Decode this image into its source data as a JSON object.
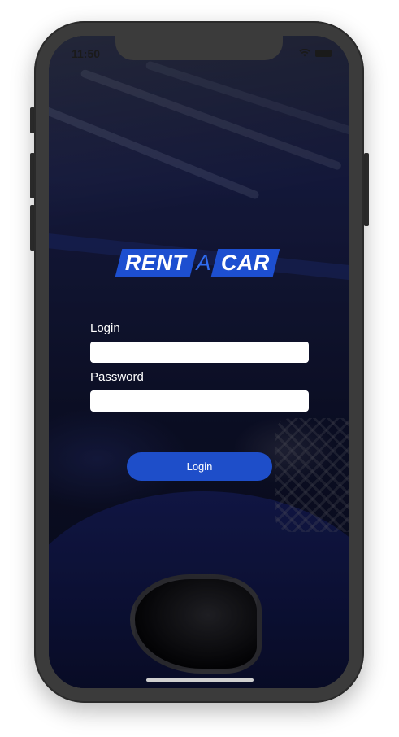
{
  "status_bar": {
    "time": "11:50",
    "icons": [
      "wifi-icon",
      "battery-icon"
    ]
  },
  "logo": {
    "word1": "RENT",
    "word2": "A",
    "word3": "CAR"
  },
  "form": {
    "login_label": "Login",
    "login_value": "",
    "password_label": "Password",
    "password_value": ""
  },
  "login_button": {
    "label": "Login"
  },
  "colors": {
    "brand_blue": "#1d4fd0",
    "button_blue": "#1e4ec9",
    "frame": "#3b3b3b"
  }
}
